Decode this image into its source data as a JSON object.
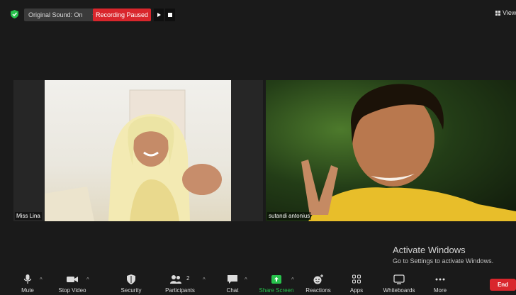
{
  "topbar": {
    "original_sound": "Original Sound: On",
    "recording_status": "Recording Paused",
    "view_label": "View"
  },
  "tiles": [
    {
      "name": "Miss Lina"
    },
    {
      "name": "sutandi antonius"
    }
  ],
  "watermark": {
    "title": "Activate Windows",
    "subtitle": "Go to Settings to activate Windows."
  },
  "toolbar": {
    "mute": "Mute",
    "stop_video": "Stop Video",
    "security": "Security",
    "participants": "Participants",
    "participants_count": "2",
    "chat": "Chat",
    "share_screen": "Share Screen",
    "reactions": "Reactions",
    "apps": "Apps",
    "whiteboards": "Whiteboards",
    "more": "More",
    "end": "End"
  },
  "colors": {
    "recording_red": "#d9262c",
    "share_green": "#27c24c",
    "background": "#1a1a1a"
  }
}
